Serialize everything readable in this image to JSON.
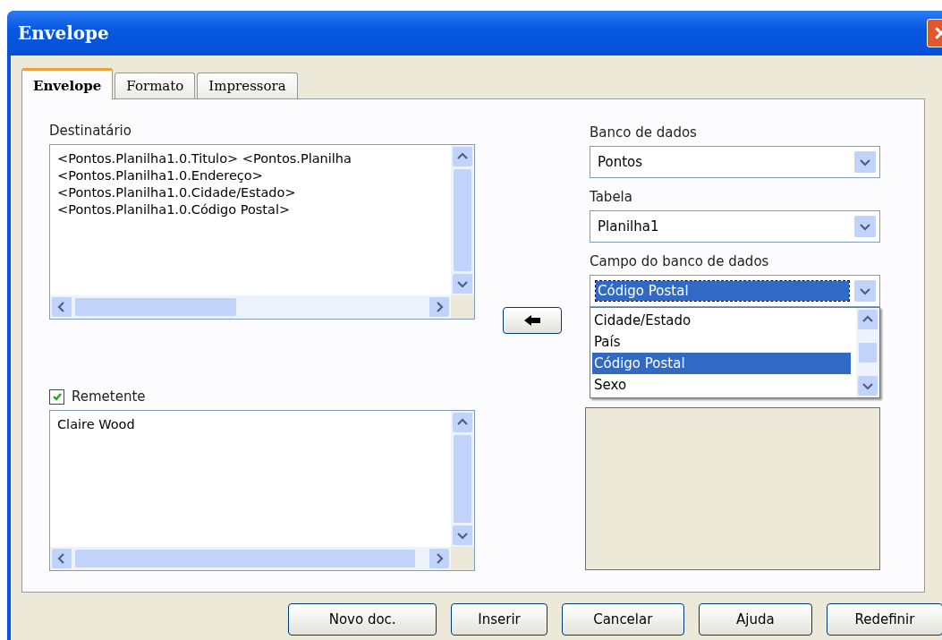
{
  "window": {
    "title": "Envelope"
  },
  "tabs": [
    {
      "label": "Envelope",
      "selected": true
    },
    {
      "label": "Formato",
      "selected": false
    },
    {
      "label": "Impressora",
      "selected": false
    }
  ],
  "recipient": {
    "label": "Destinatário",
    "lines": [
      "<Pontos.Planilha1.0.Titulo> <Pontos.Planilha",
      "<Pontos.Planilha1.0.Endereço>",
      "<Pontos.Planilha1.0.Cidade/Estado>",
      "<Pontos.Planilha1.0.Código Postal>"
    ]
  },
  "sender": {
    "label": "Remetente",
    "checked": true,
    "lines": [
      "Claire Wood"
    ]
  },
  "database": {
    "label": "Banco de dados",
    "value": "Pontos"
  },
  "table": {
    "label": "Tabela",
    "value": "Planilha1"
  },
  "field": {
    "label": "Campo do banco de dados",
    "value": "Código Postal",
    "expanded": true,
    "options": [
      {
        "label": "Cidade/Estado",
        "selected": false
      },
      {
        "label": "País",
        "selected": false
      },
      {
        "label": "Código Postal",
        "selected": true
      },
      {
        "label": "Sexo",
        "selected": false
      }
    ]
  },
  "buttons": [
    "Novo doc.",
    "Inserir",
    "Cancelar",
    "Ajuda",
    "Redefinir"
  ]
}
